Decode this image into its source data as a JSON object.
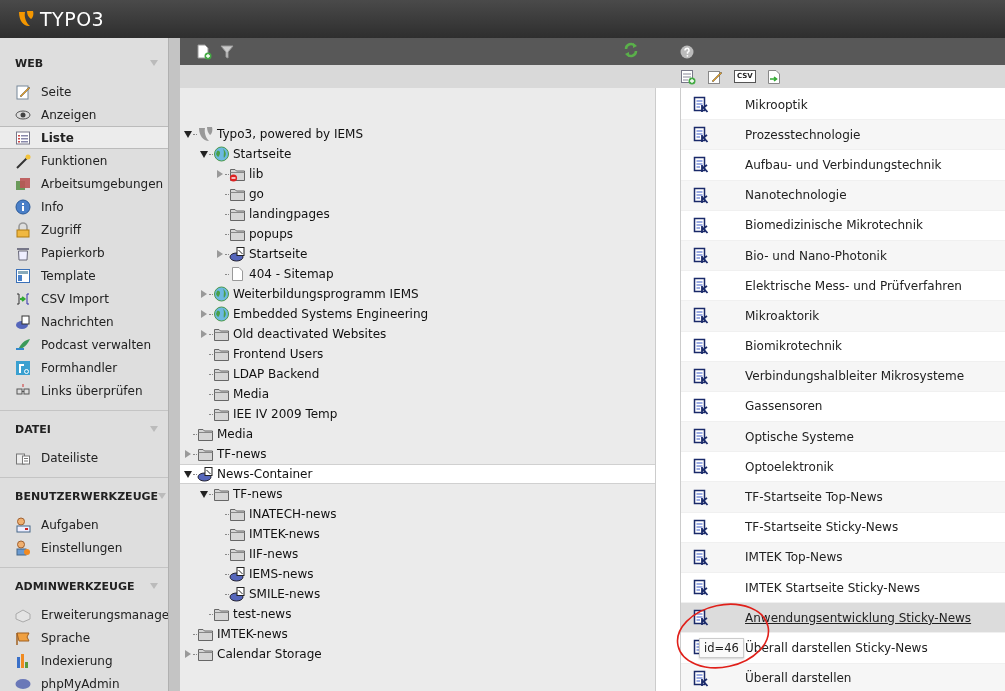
{
  "app": {
    "logo": "TYPO3"
  },
  "sidebar": {
    "groups": [
      {
        "title": "WEB",
        "items": [
          {
            "label": "Seite",
            "selected": false
          },
          {
            "label": "Anzeigen",
            "selected": false
          },
          {
            "label": "Liste",
            "selected": true
          },
          {
            "label": "Funktionen",
            "selected": false
          },
          {
            "label": "Arbeitsumgebungen",
            "selected": false
          },
          {
            "label": "Info",
            "selected": false
          },
          {
            "label": "Zugriff",
            "selected": false
          },
          {
            "label": "Papierkorb",
            "selected": false
          },
          {
            "label": "Template",
            "selected": false
          },
          {
            "label": "CSV Import",
            "selected": false
          },
          {
            "label": "Nachrichten",
            "selected": false
          },
          {
            "label": "Podcast verwalten",
            "selected": false
          },
          {
            "label": "Formhandler",
            "selected": false
          },
          {
            "label": "Links überprüfen",
            "selected": false
          }
        ]
      },
      {
        "title": "DATEI",
        "items": [
          {
            "label": "Dateiliste",
            "selected": false
          }
        ]
      },
      {
        "title": "BENUTZERWERKZEUGE",
        "items": [
          {
            "label": "Aufgaben",
            "selected": false
          },
          {
            "label": "Einstellungen",
            "selected": false
          }
        ]
      },
      {
        "title": "ADMINWERKZEUGE",
        "items": [
          {
            "label": "Erweiterungsmanage",
            "selected": false
          },
          {
            "label": "Sprache",
            "selected": false
          },
          {
            "label": "Indexierung",
            "selected": false
          },
          {
            "label": "phpMyAdmin",
            "selected": false
          }
        ]
      }
    ]
  },
  "list_toolbar": {
    "csv_label": "CSV"
  },
  "tree": {
    "items": [
      {
        "label": "Typo3, powered by IEMS",
        "kind": "typo3",
        "expanded": true,
        "selected": false,
        "children": [
          {
            "label": "Startseite",
            "kind": "globe",
            "expanded": true,
            "selected": false,
            "children": [
              {
                "label": "lib",
                "kind": "folder-restricted",
                "expanded": false,
                "selected": false
              },
              {
                "label": "go",
                "kind": "folder",
                "selected": false
              },
              {
                "label": "landingpages",
                "kind": "folder",
                "selected": false
              },
              {
                "label": "popups",
                "kind": "folder",
                "selected": false
              },
              {
                "label": "Startseite",
                "kind": "news",
                "expanded": false,
                "selected": false
              },
              {
                "label": "404 - Sitemap",
                "kind": "page",
                "selected": false
              }
            ]
          },
          {
            "label": "Weiterbildungsprogramm IEMS",
            "kind": "globe",
            "expanded": false,
            "selected": false
          },
          {
            "label": "Embedded Systems Engineering",
            "kind": "globe",
            "expanded": false,
            "selected": false
          },
          {
            "label": "Old deactivated Websites",
            "kind": "folder",
            "expanded": false,
            "selected": false
          },
          {
            "label": "Frontend Users",
            "kind": "folder",
            "selected": false
          },
          {
            "label": "LDAP Backend",
            "kind": "folder",
            "selected": false
          },
          {
            "label": "Media",
            "kind": "folder",
            "selected": false
          },
          {
            "label": "IEE IV 2009 Temp",
            "kind": "folder",
            "selected": false
          }
        ]
      },
      {
        "label": "Media",
        "kind": "folder",
        "selected": false
      },
      {
        "label": "TF-news",
        "kind": "folder",
        "expanded": false,
        "selected": false
      },
      {
        "label": "News-Container",
        "kind": "news",
        "expanded": true,
        "selected": true,
        "children": [
          {
            "label": "TF-news",
            "kind": "folder",
            "expanded": true,
            "selected": false,
            "children": [
              {
                "label": "INATECH-news",
                "kind": "folder",
                "selected": false
              },
              {
                "label": "IMTEK-news",
                "kind": "folder",
                "selected": false
              },
              {
                "label": "IIF-news",
                "kind": "folder",
                "selected": false
              },
              {
                "label": "IEMS-news",
                "kind": "news",
                "selected": false
              },
              {
                "label": "SMILE-news",
                "kind": "news",
                "selected": false
              }
            ]
          },
          {
            "label": "test-news",
            "kind": "folder",
            "selected": false
          }
        ]
      },
      {
        "label": "IMTEK-news",
        "kind": "folder",
        "selected": false
      },
      {
        "label": "Calendar Storage",
        "kind": "folder",
        "expanded": false,
        "selected": false
      }
    ]
  },
  "records": [
    {
      "title": "Mikrooptik",
      "hovered": false
    },
    {
      "title": "Prozesstechnologie",
      "hovered": false
    },
    {
      "title": "Aufbau- und Verbindungstechnik",
      "hovered": false
    },
    {
      "title": "Nanotechnologie",
      "hovered": false
    },
    {
      "title": "Biomedizinische Mikrotechnik",
      "hovered": false
    },
    {
      "title": "Bio- und Nano-Photonik",
      "hovered": false
    },
    {
      "title": "Elektrische Mess- und Prüfverfahren",
      "hovered": false
    },
    {
      "title": "Mikroaktorik",
      "hovered": false
    },
    {
      "title": "Biomikrotechnik",
      "hovered": false
    },
    {
      "title": "Verbindungshalbleiter Mikrosysteme",
      "hovered": false
    },
    {
      "title": "Gassensoren",
      "hovered": false
    },
    {
      "title": "Optische Systeme",
      "hovered": false
    },
    {
      "title": "Optoelektronik",
      "hovered": false
    },
    {
      "title": "TF-Startseite Top-News",
      "hovered": false
    },
    {
      "title": "TF-Startseite Sticky-News",
      "hovered": false
    },
    {
      "title": "IMTEK Top-News",
      "hovered": false
    },
    {
      "title": "IMTEK Startseite Sticky-News",
      "hovered": false
    },
    {
      "title": "Anwendungsentwicklung Sticky-News",
      "hovered": true
    },
    {
      "title": "Überall darstellen Sticky-News",
      "hovered": false,
      "tooltip": "id=46"
    },
    {
      "title": "Überall darstellen",
      "hovered": false
    }
  ]
}
